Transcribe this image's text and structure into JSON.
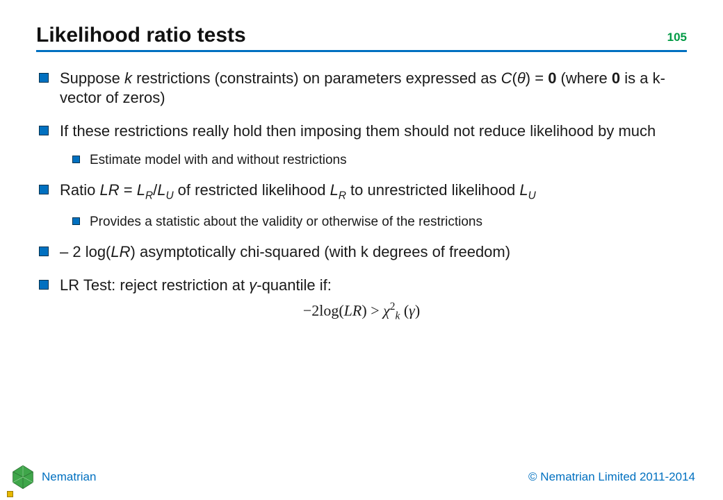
{
  "header": {
    "title": "Likelihood ratio tests",
    "page_number": "105"
  },
  "content": {
    "b1_pre": "Suppose ",
    "b1_k": "k",
    "b1_mid": " restrictions (constraints) on parameters expressed as ",
    "b1_c": "C",
    "b1_paren_open": "(",
    "b1_theta": "θ",
    "b1_paren_close_eq": ") = ",
    "b1_zero1": "0",
    "b1_where": " (where ",
    "b1_zero2": "0",
    "b1_tail": " is a k-vector of zeros)",
    "b2": "If these restrictions really hold then imposing them should not reduce likelihood by much",
    "b2_s1": "Estimate model with and without restrictions",
    "b3_pre": "Ratio ",
    "b3_lr": "LR",
    "b3_eq": " = ",
    "b3_l1": "L",
    "b3_r": "R",
    "b3_slash": "/",
    "b3_l2": "L",
    "b3_u": "U",
    "b3_mid": " of restricted likelihood ",
    "b3_l3": "L",
    "b3_mid2": " to unrestricted likelihood ",
    "b3_l4": "L",
    "b3_s1": "Provides a statistic about the validity or otherwise of the restrictions",
    "b4_pre": "– 2 log(",
    "b4_lr": "LR",
    "b4_tail": ") asymptotically chi-squared (with k degrees of freedom)",
    "b5_pre": "LR Test: reject restriction at ",
    "b5_gamma": "γ",
    "b5_tail": "-quantile if:",
    "eq_neg2log": "−2log",
    "eq_lp1": "(",
    "eq_lr": "LR",
    "eq_rp1": ")",
    "eq_gt": " > ",
    "eq_chi": "χ",
    "eq_sup2": "2",
    "eq_k": "k",
    "eq_lp2": "(",
    "eq_gamma": "γ",
    "eq_rp2": ")"
  },
  "footer": {
    "brand": "Nematrian",
    "copyright": "© Nematrian Limited 2011-2014"
  }
}
